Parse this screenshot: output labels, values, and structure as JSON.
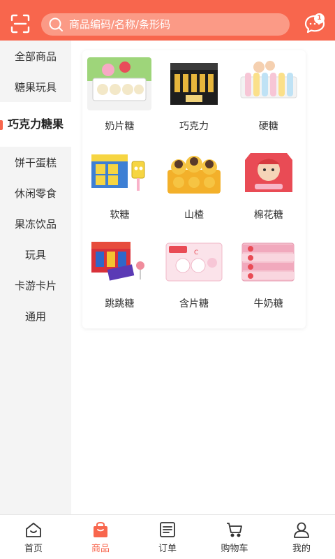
{
  "header": {
    "search_placeholder": "商品编码/名称/条形码",
    "message_badge": "1"
  },
  "sidebar": {
    "items": [
      {
        "label": "全部商品"
      },
      {
        "label": "糖果玩具"
      },
      {
        "label": "巧克力糖果",
        "active": true
      },
      {
        "label": "饼干蛋糕"
      },
      {
        "label": "休闲零食"
      },
      {
        "label": "果冻饮品"
      },
      {
        "label": "玩具"
      },
      {
        "label": "卡游卡片"
      },
      {
        "label": "通用"
      }
    ]
  },
  "products": [
    {
      "name": "奶片糖"
    },
    {
      "name": "巧克力"
    },
    {
      "name": "硬糖"
    },
    {
      "name": "软糖"
    },
    {
      "name": "山楂"
    },
    {
      "name": "棉花糖"
    },
    {
      "name": "跳跳糖"
    },
    {
      "name": "含片糖"
    },
    {
      "name": "牛奶糖"
    }
  ],
  "nav": {
    "home": "首页",
    "products": "商品",
    "orders": "订单",
    "cart": "购物车",
    "mine": "我的"
  },
  "colors": {
    "accent": "#f8664d",
    "search_bg": "#fb9a86"
  }
}
